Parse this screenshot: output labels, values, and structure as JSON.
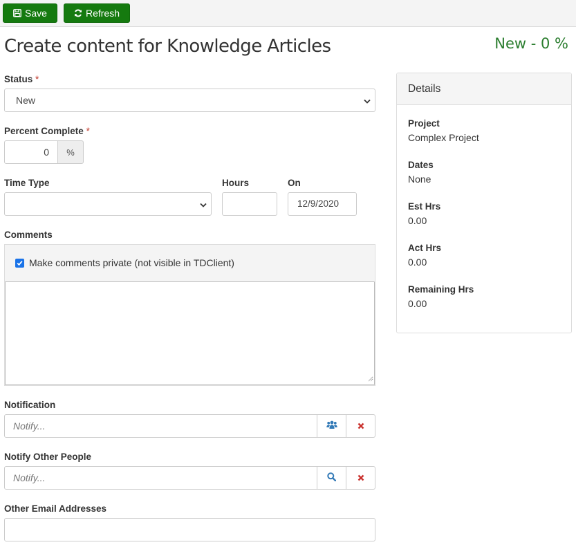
{
  "toolbar": {
    "save_label": "Save",
    "save_icon": "floppy-disk-icon",
    "refresh_label": "Refresh",
    "refresh_icon": "refresh-icon"
  },
  "header": {
    "title": "Create content for Knowledge Articles",
    "status_summary": "New - 0 %"
  },
  "form": {
    "status": {
      "label": "Status",
      "required_mark": "*",
      "value": "New"
    },
    "percent_complete": {
      "label": "Percent Complete",
      "required_mark": "*",
      "value": "0",
      "addon": "%"
    },
    "time_type": {
      "label": "Time Type",
      "value": ""
    },
    "hours": {
      "label": "Hours",
      "value": ""
    },
    "on": {
      "label": "On",
      "value": "12/9/2020"
    },
    "comments": {
      "label": "Comments",
      "private_checkbox_label": "Make comments private (not visible in TDClient)",
      "private_checked": true,
      "value": ""
    },
    "notification": {
      "label": "Notification",
      "placeholder": "Notify...",
      "lookup_icon": "users-icon",
      "clear_icon": "close-icon"
    },
    "notify_other_people": {
      "label": "Notify Other People",
      "placeholder": "Notify...",
      "lookup_icon": "search-icon",
      "clear_icon": "close-icon"
    },
    "other_email_addresses": {
      "label": "Other Email Addresses",
      "value": ""
    }
  },
  "details": {
    "title": "Details",
    "items": [
      {
        "label": "Project",
        "value": "Complex Project"
      },
      {
        "label": "Dates",
        "value": "None"
      },
      {
        "label": "Est Hrs",
        "value": "0.00"
      },
      {
        "label": "Act Hrs",
        "value": "0.00"
      },
      {
        "label": "Remaining Hrs",
        "value": "0.00"
      }
    ]
  },
  "colors": {
    "primary_button": "#157a0f",
    "status_summary": "#2a7d2e",
    "required": "#c0392b",
    "icon_blue": "#337ab7",
    "icon_red": "#c9302c"
  }
}
